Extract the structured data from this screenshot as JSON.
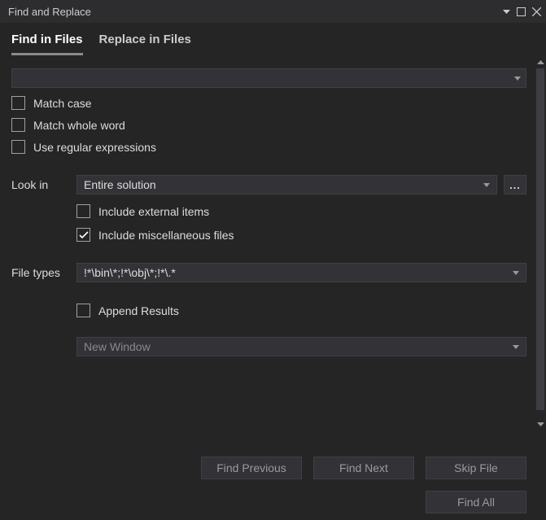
{
  "title": "Find and Replace",
  "tabs": {
    "find": "Find in Files",
    "replace": "Replace in Files",
    "active": "find"
  },
  "search": {
    "value": ""
  },
  "options": {
    "match_case": "Match case",
    "match_whole": "Match whole word",
    "regex": "Use regular expressions"
  },
  "look_in": {
    "label": "Look in",
    "value": "Entire solution",
    "browse": "..."
  },
  "look_in_opts": {
    "include_external": "Include external items",
    "include_misc": "Include miscellaneous files"
  },
  "file_types": {
    "label": "File types",
    "value": "!*\\bin\\*;!*\\obj\\*;!*\\.*"
  },
  "results": {
    "append": "Append Results",
    "window": "New Window"
  },
  "buttons": {
    "find_prev": "Find Previous",
    "find_next": "Find Next",
    "skip_file": "Skip File",
    "find_all": "Find All"
  }
}
